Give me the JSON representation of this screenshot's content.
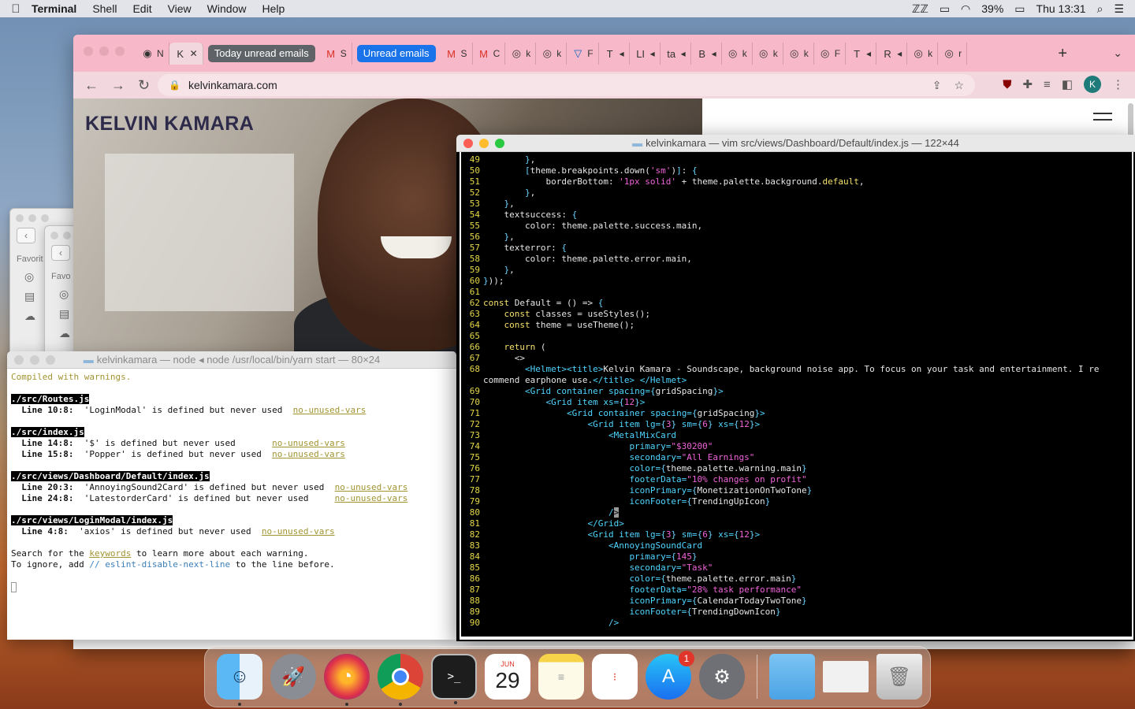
{
  "menubar": {
    "app_name": "Terminal",
    "items": [
      "Shell",
      "Edit",
      "View",
      "Window",
      "Help"
    ],
    "battery": "39%",
    "clock": "Thu 13:31"
  },
  "chrome": {
    "tabs": [
      {
        "fav": "◉",
        "title": "N"
      },
      {
        "fav": "K",
        "title": "Ke",
        "active": true
      }
    ],
    "group1": "Today unread emails",
    "group2": "Unread emails",
    "more_tabs": [
      {
        "fav": "M",
        "title": "S"
      },
      {
        "fav": "M",
        "title": "C"
      },
      {
        "fav": "◎",
        "title": "k"
      },
      {
        "fav": "◎",
        "title": "k"
      },
      {
        "fav": "▽",
        "title": "F"
      },
      {
        "fav": "T",
        "title": "🔈"
      },
      {
        "fav": "LI",
        "title": "🔈"
      },
      {
        "fav": "ta",
        "title": "🔈"
      },
      {
        "fav": "B",
        "title": "🔈"
      },
      {
        "fav": "◎",
        "title": "k"
      },
      {
        "fav": "◎",
        "title": "k"
      },
      {
        "fav": "◎",
        "title": "k"
      },
      {
        "fav": "◎",
        "title": "F"
      },
      {
        "fav": "T",
        "title": "🔈"
      },
      {
        "fav": "R",
        "title": "🔈"
      },
      {
        "fav": "◎",
        "title": "k"
      },
      {
        "fav": "◎",
        "title": "r"
      }
    ],
    "url": "kelvinkamara.com",
    "avatar": "K",
    "site_brand": "KELVIN KAMARA"
  },
  "finder": {
    "favorites_label": "Favorit",
    "favorites_label2": "Favo"
  },
  "node_term": {
    "title": "kelvinkamara — node ◂ node /usr/local/bin/yarn start — 80×24",
    "compiled": "Compiled with warnings.",
    "blocks": [
      {
        "file": "./src/Routes.js",
        "lines": [
          {
            "loc": "  Line 10:8:  ",
            "msg": "'LoginModal' is defined but never used  ",
            "rule": "no-unused-vars"
          }
        ]
      },
      {
        "file": "./src/index.js",
        "lines": [
          {
            "loc": "  Line 14:8:  ",
            "msg": "'$' is defined but never used       ",
            "rule": "no-unused-vars"
          },
          {
            "loc": "  Line 15:8:  ",
            "msg": "'Popper' is defined but never used  ",
            "rule": "no-unused-vars"
          }
        ]
      },
      {
        "file": "./src/views/Dashboard/Default/index.js",
        "lines": [
          {
            "loc": "  Line 20:3:  ",
            "msg": "'AnnoyingSound2Card' is defined but never used  ",
            "rule": "no-unused-vars"
          },
          {
            "loc": "  Line 24:8:  ",
            "msg": "'LatestorderCard' is defined but never used     ",
            "rule": "no-unused-vars"
          }
        ]
      },
      {
        "file": "./src/views/LoginModal/index.js",
        "lines": [
          {
            "loc": "  Line 4:8:  ",
            "msg": "'axios' is defined but never used  ",
            "rule": "no-unused-vars"
          }
        ]
      }
    ],
    "search_pre": "Search for the ",
    "search_kw": "keywords",
    "search_post": " to learn more about each warning.",
    "ignore_pre": "To ignore, add ",
    "ignore_cmt": "// eslint-disable-next-line",
    "ignore_post": " to the line before."
  },
  "vim_term": {
    "title": "kelvinkamara — vim src/views/Dashboard/Default/index.js — 122×44",
    "lines": [
      {
        "n": "49",
        "html": "        <span class=\"k\">}</span>,"
      },
      {
        "n": "50",
        "html": "        <span class=\"k\">[</span>theme.breakpoints.down(<span class=\"s\">'sm'</span>)<span class=\"k\">]</span>: <span class=\"k\">{</span>"
      },
      {
        "n": "51",
        "html": "            borderBottom: <span class=\"s\">'1px solid'</span> + theme.palette.background.<span class=\"y\">default</span>,"
      },
      {
        "n": "52",
        "html": "        <span class=\"k\">}</span>,"
      },
      {
        "n": "53",
        "html": "    <span class=\"k\">}</span>,"
      },
      {
        "n": "54",
        "html": "    textsuccess: <span class=\"k\">{</span>"
      },
      {
        "n": "55",
        "html": "        color: theme.palette.success.main,"
      },
      {
        "n": "56",
        "html": "    <span class=\"k\">}</span>,"
      },
      {
        "n": "57",
        "html": "    texterror: <span class=\"k\">{</span>"
      },
      {
        "n": "58",
        "html": "        color: theme.palette.error.main,"
      },
      {
        "n": "59",
        "html": "    <span class=\"k\">}</span>,"
      },
      {
        "n": "60",
        "html": "<span class=\"k\">}</span>));"
      },
      {
        "n": "61",
        "html": ""
      },
      {
        "n": "62",
        "html": "<span class=\"y\">const</span> Default = () =&gt; <span class=\"k\">{</span>"
      },
      {
        "n": "63",
        "html": "    <span class=\"y\">const</span> classes = useStyles();"
      },
      {
        "n": "64",
        "html": "    <span class=\"y\">const</span> theme = useTheme();"
      },
      {
        "n": "65",
        "html": ""
      },
      {
        "n": "66",
        "html": "    <span class=\"y\">return</span> ("
      },
      {
        "n": "67",
        "html": "      &lt;&gt;"
      },
      {
        "n": "68",
        "html": "        <span class=\"t\">&lt;Helmet&gt;&lt;title&gt;</span>Kelvin Kamara - Soundscape, background noise app. To focus on your task and entertainment. I re"
      },
      {
        "n": "",
        "html": "commend earphone use.<span class=\"t\">&lt;/title&gt;</span> <span class=\"t\">&lt;/Helmet&gt;</span>"
      },
      {
        "n": "69",
        "html": "        <span class=\"t\">&lt;Grid</span> <span class=\"t\">container</span> <span class=\"t\">spacing=</span><span class=\"k\">{</span>gridSpacing<span class=\"k\">}</span><span class=\"t\">&gt;</span>"
      },
      {
        "n": "70",
        "html": "            <span class=\"t\">&lt;Grid</span> <span class=\"t\">item</span> <span class=\"t\">xs=</span><span class=\"k\">{</span><span class=\"s\">12</span><span class=\"k\">}</span><span class=\"t\">&gt;</span>"
      },
      {
        "n": "71",
        "html": "                <span class=\"t\">&lt;Grid</span> <span class=\"t\">container</span> <span class=\"t\">spacing=</span><span class=\"k\">{</span>gridSpacing<span class=\"k\">}</span><span class=\"t\">&gt;</span>"
      },
      {
        "n": "72",
        "html": "                    <span class=\"t\">&lt;Grid</span> <span class=\"t\">item</span> <span class=\"t\">lg=</span><span class=\"k\">{</span><span class=\"s\">3</span><span class=\"k\">}</span> <span class=\"t\">sm=</span><span class=\"k\">{</span><span class=\"s\">6</span><span class=\"k\">}</span> <span class=\"t\">xs=</span><span class=\"k\">{</span><span class=\"s\">12</span><span class=\"k\">}</span><span class=\"t\">&gt;</span>"
      },
      {
        "n": "73",
        "html": "                        <span class=\"t\">&lt;MetalMixCard</span>"
      },
      {
        "n": "74",
        "html": "                            <span class=\"t\">primary=</span><span class=\"s\">\"$30200\"</span>"
      },
      {
        "n": "75",
        "html": "                            <span class=\"t\">secondary=</span><span class=\"s\">\"All Earnings\"</span>"
      },
      {
        "n": "76",
        "html": "                            <span class=\"t\">color=</span><span class=\"k\">{</span>theme.palette.warning.main<span class=\"k\">}</span>"
      },
      {
        "n": "77",
        "html": "                            <span class=\"t\">footerData=</span><span class=\"s\">\"10% changes on profit\"</span>"
      },
      {
        "n": "78",
        "html": "                            <span class=\"t\">iconPrimary=</span><span class=\"k\">{</span>MonetizationOnTwoTone<span class=\"k\">}</span>"
      },
      {
        "n": "79",
        "html": "                            <span class=\"t\">iconFooter=</span><span class=\"k\">{</span>TrendingUpIcon<span class=\"k\">}</span>"
      },
      {
        "n": "80",
        "html": "                        <span class=\"t\">/</span><span class=\"curs\">&gt;</span>"
      },
      {
        "n": "81",
        "html": "                    <span class=\"t\">&lt;/Grid&gt;</span>"
      },
      {
        "n": "82",
        "html": "                    <span class=\"t\">&lt;Grid</span> <span class=\"t\">item</span> <span class=\"t\">lg=</span><span class=\"k\">{</span><span class=\"s\">3</span><span class=\"k\">}</span> <span class=\"t\">sm=</span><span class=\"k\">{</span><span class=\"s\">6</span><span class=\"k\">}</span> <span class=\"t\">xs=</span><span class=\"k\">{</span><span class=\"s\">12</span><span class=\"k\">}</span><span class=\"t\">&gt;</span>"
      },
      {
        "n": "83",
        "html": "                        <span class=\"t\">&lt;AnnoyingSoundCard</span>"
      },
      {
        "n": "84",
        "html": "                            <span class=\"t\">primary=</span><span class=\"k\">{</span><span class=\"s\">145</span><span class=\"k\">}</span>"
      },
      {
        "n": "85",
        "html": "                            <span class=\"t\">secondary=</span><span class=\"s\">\"Task\"</span>"
      },
      {
        "n": "86",
        "html": "                            <span class=\"t\">color=</span><span class=\"k\">{</span>theme.palette.error.main<span class=\"k\">}</span>"
      },
      {
        "n": "87",
        "html": "                            <span class=\"t\">footerData=</span><span class=\"s\">\"28% task performance\"</span>"
      },
      {
        "n": "88",
        "html": "                            <span class=\"t\">iconPrimary=</span><span class=\"k\">{</span>CalendarTodayTwoTone<span class=\"k\">}</span>"
      },
      {
        "n": "89",
        "html": "                            <span class=\"t\">iconFooter=</span><span class=\"k\">{</span>TrendingDownIcon<span class=\"k\">}</span>"
      },
      {
        "n": "90",
        "html": "                        <span class=\"t\">/&gt;</span>"
      }
    ]
  },
  "dock": {
    "calendar_month": "JUN",
    "calendar_day": "29",
    "appstore_badge": "1"
  }
}
